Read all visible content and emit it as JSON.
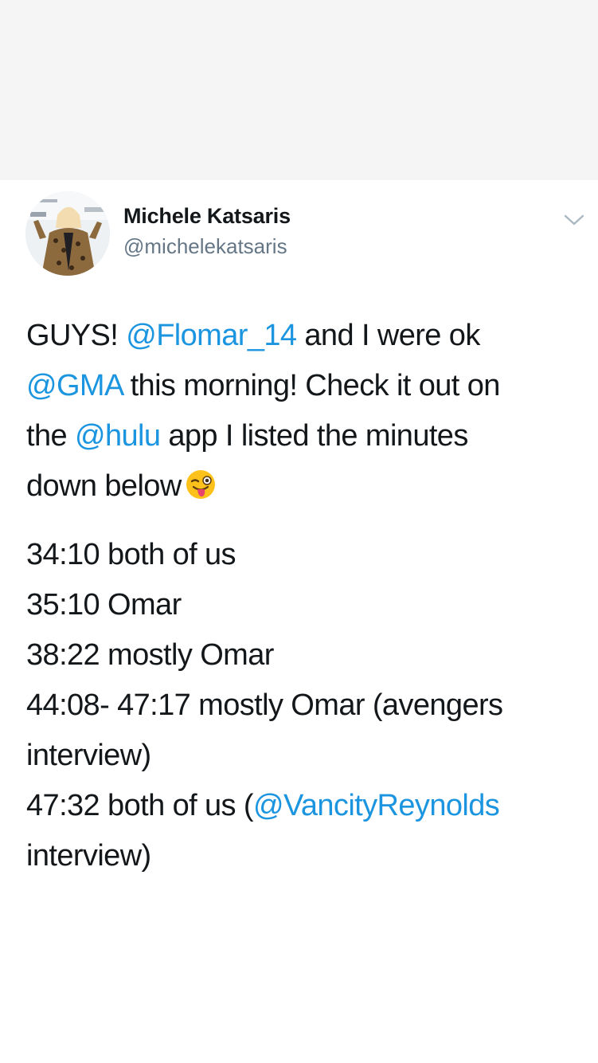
{
  "tweet": {
    "author_name": "Michele Katsaris",
    "author_handle": "@michelekatsaris",
    "text": {
      "p1_t1": "GUYS! ",
      "p1_m1": "@Flomar_14",
      "p1_t2": " and I were ok",
      "p1_m2": "@GMA",
      "p1_t3": " this morning! Check it out on",
      "p1_t4": "the ",
      "p1_m3": "@hulu",
      "p1_t5": " app I listed the minutes",
      "p1_t6": "down below",
      "emoji_name": "winking-face-with-tongue-icon",
      "line1": "34:10 both of us",
      "line2": "35:10 Omar",
      "line3": "38:22 mostly Omar",
      "line4a": "44:08- 47:17 mostly Omar (avengers",
      "line4b": "interview)",
      "line5_t1": "47:32 both of us (",
      "line5_m1": "@VancityReynolds",
      "line5b": "interview)"
    }
  },
  "colors": {
    "mention": "#1b95e0",
    "text": "#14171a",
    "secondary": "#657786",
    "top_band": "#f5f5f5"
  }
}
